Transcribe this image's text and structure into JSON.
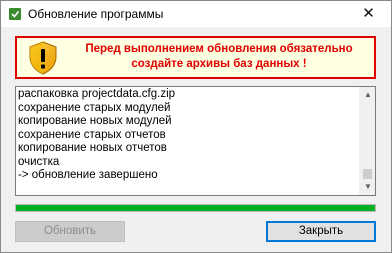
{
  "window": {
    "title": "Обновление программы",
    "close_glyph": "✕"
  },
  "warning": {
    "line1": "Перед выполнением обновления обязательно",
    "line2": "создайте архивы баз данных !",
    "color": "#e00000",
    "icon": "shield-warning-icon"
  },
  "log": {
    "lines": [
      "распаковка projectdata.cfg.zip",
      "сохранение старых модулей",
      "копирование новых модулей",
      "сохранение старых отчетов",
      "копирование новых отчетов",
      "очистка",
      "-> обновление завершено"
    ]
  },
  "progress": {
    "value": 1.0,
    "color": "#06b025"
  },
  "buttons": {
    "update_label": "Обновить",
    "close_label": "Закрыть"
  }
}
